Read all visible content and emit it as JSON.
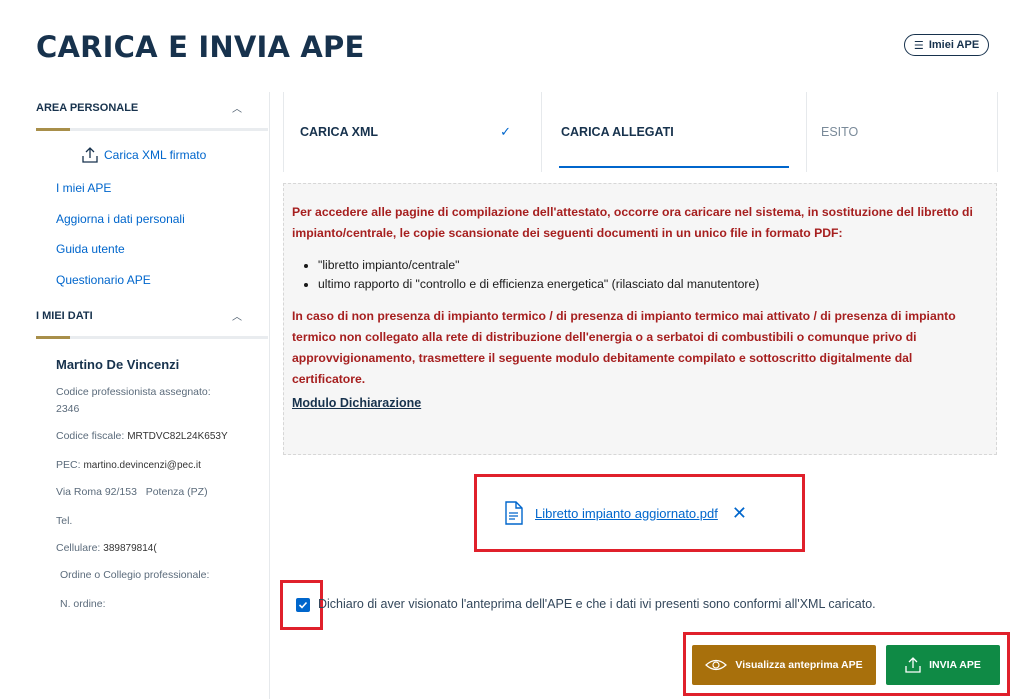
{
  "header": {
    "title": "CARICA E INVIA APE",
    "miei_ape_button": "Imiei APE"
  },
  "sidebar": {
    "area_personale": "AREA PERSONALE",
    "upload_link": "Carica XML firmato",
    "links": [
      "I miei APE",
      "Aggiorna i dati personali",
      "Guida utente",
      "Questionario APE"
    ],
    "miei_dati": "I MIEI DATI",
    "user": {
      "name": "Martino De Vincenzi",
      "codice_prof_label": "Codice professionista assegnato:",
      "codice_prof_value": "2346",
      "codice_fiscale_label": "Codice fiscale:",
      "codice_fiscale_value": "MRTDVC82L24K653Y",
      "pec_label": "PEC:",
      "pec_value": "martino.devincenzi@pec.it",
      "address": "Via Roma 92/153",
      "city": "Potenza (PZ)",
      "tel_label": "Tel.",
      "cellulare_label": "Cellulare:",
      "cellulare_value": "389879814(",
      "ordine_label": "Ordine o Collegio professionale:",
      "n_ordine_label": "N. ordine:"
    }
  },
  "stepper": {
    "step1": "CARICA XML",
    "step2": "CARICA ALLEGATI",
    "step3": "ESITO"
  },
  "notice": {
    "intro": "Per accedere alle pagine di compilazione dell'attestato, occorre ora caricare nel sistema, in sostituzione del libretto di impianto/centrale, le copie scansionate dei seguenti documenti in un unico file in formato PDF:",
    "bullets": [
      "\"libretto impianto/centrale\"",
      "ultimo rapporto di \"controllo e di efficienza energetica\" (rilasciato dal manutentore)"
    ],
    "second": "In caso di non presenza di impianto termico / di presenza di impianto termico mai attivato / di presenza di impianto termico non collegato alla rete di distribuzione dell'energia o a serbatoi di combustibili o comunque privo di approvvigionamento, trasmettere il seguente modulo debitamente compilato e sottoscritto digitalmente dal certificatore.",
    "link": "Modulo Dichiarazione"
  },
  "file": {
    "name": "Libretto impianto aggiornato.pdf"
  },
  "declaration": {
    "checked": true,
    "label": "Dichiaro di aver visionato l'anteprima dell'APE e che i dati ivi presenti sono conformi all'XML caricato."
  },
  "actions": {
    "preview": "Visualizza anteprima APE",
    "send": "INVIA APE"
  },
  "colors": {
    "navy": "#17324d",
    "link": "#0066cc",
    "warning_text": "#a61f1f",
    "preview_btn": "#a8700c",
    "send_btn": "#0f8a45",
    "highlight": "#e0202b"
  }
}
